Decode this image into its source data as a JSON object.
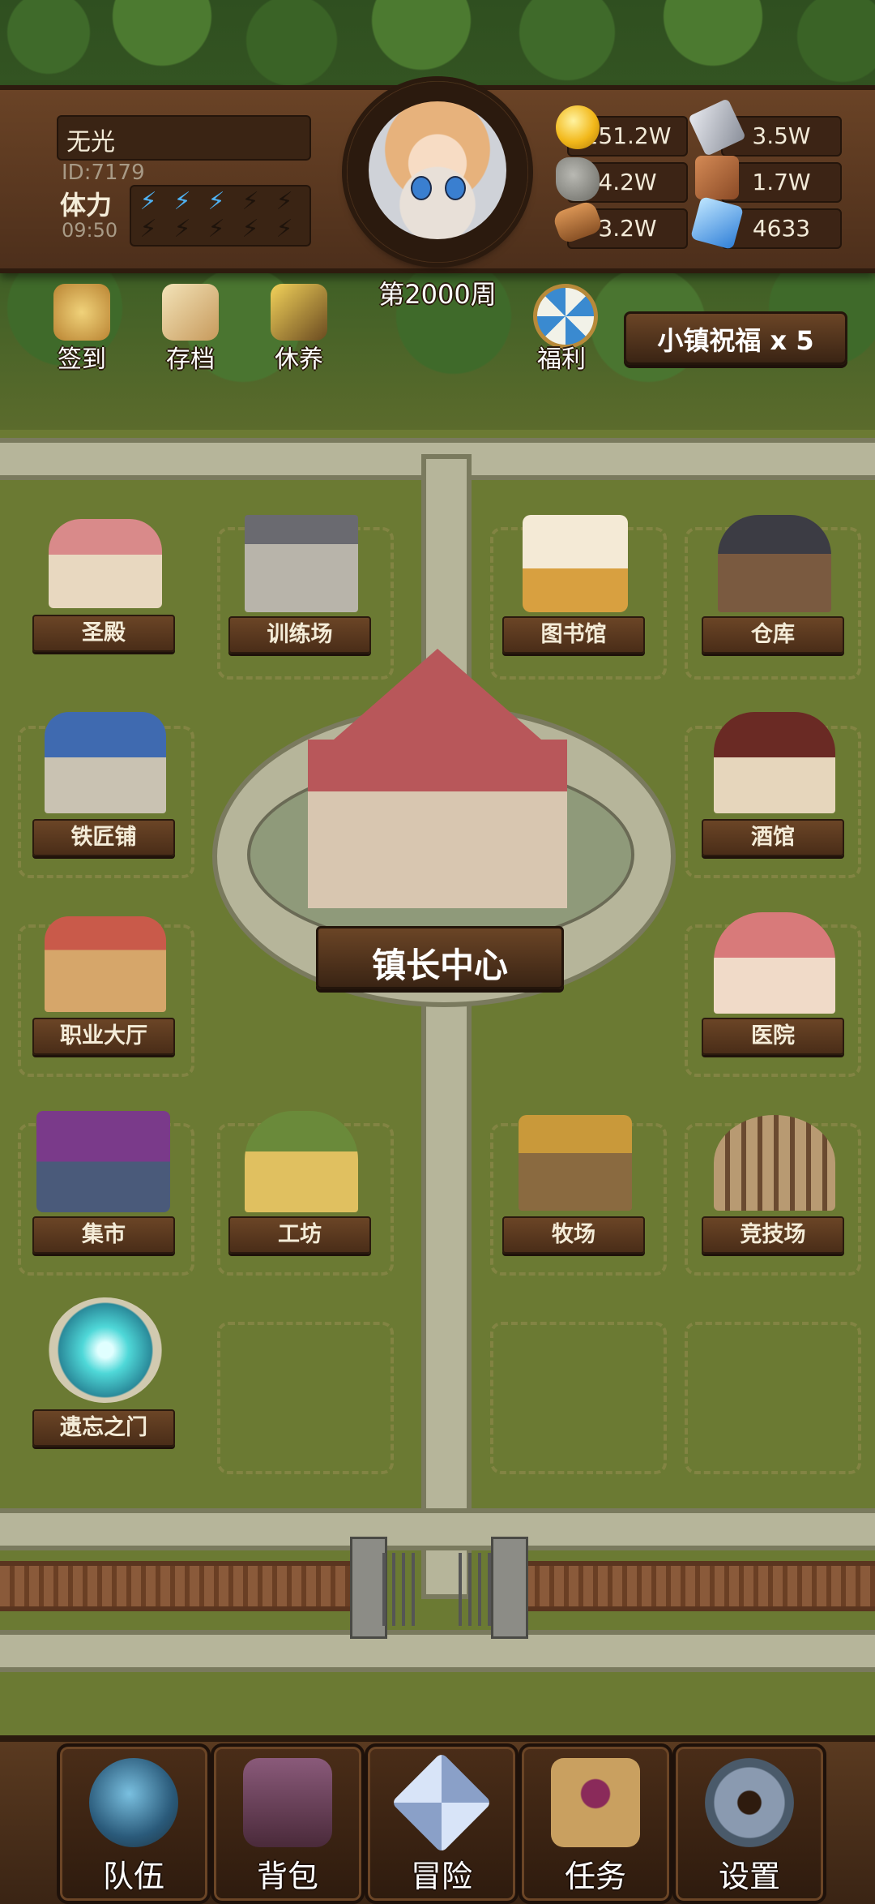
{
  "header": {
    "player_name": "无光",
    "player_id": "ID:7179",
    "stamina_label": "体力",
    "stamina_timer": "09:50",
    "stamina_filled": 3,
    "stamina_max": 10,
    "week_label": "第2000周"
  },
  "resources": {
    "gold": "251.2W",
    "iron": "3.5W",
    "stone": "4.2W",
    "leather": "1.7W",
    "wood": "3.2W",
    "crystal": "4633"
  },
  "quick_actions": {
    "sign_in": "签到",
    "save": "存档",
    "rest": "休养",
    "welfare": "福利",
    "blessing": "小镇祝福 x 5"
  },
  "buildings": {
    "shrine": "圣殿",
    "training": "训练场",
    "library": "图书馆",
    "warehouse": "仓库",
    "blacksmith": "铁匠铺",
    "tavern": "酒馆",
    "town_hall": "镇长中心",
    "job_hall": "职业大厅",
    "hospital": "医院",
    "market": "集市",
    "workshop": "工坊",
    "ranch": "牧场",
    "arena": "竞技场",
    "portal": "遗忘之门"
  },
  "nav": {
    "team": "队伍",
    "bag": "背包",
    "adventure": "冒险",
    "quest": "任务",
    "settings": "设置"
  },
  "colors": {
    "wood_dark": "#3a2414",
    "grass": "#6b7a33",
    "road": "#b6b59a",
    "stamina_bolt": "#4fb0f0"
  }
}
